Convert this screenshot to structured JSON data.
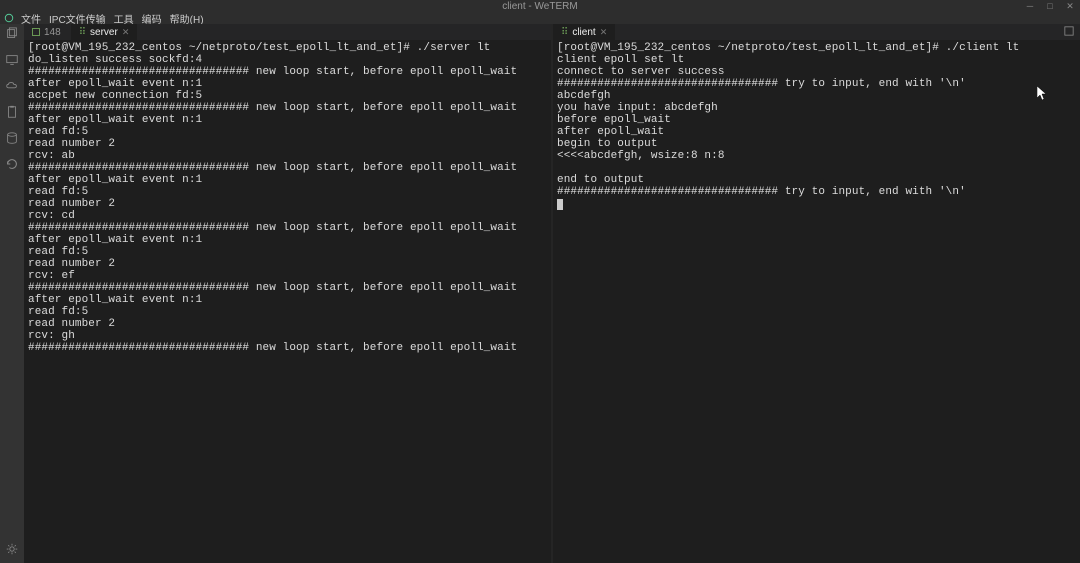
{
  "window": {
    "title": "client - WeTERM"
  },
  "menu": {
    "file": "文件",
    "ipc": "IPC文件传输",
    "tool": "工具",
    "encoding": "编码",
    "help": "帮助(H)"
  },
  "tabs": {
    "left_tab0": "148",
    "left_tab1": "server",
    "right_tab0": "client"
  },
  "server_output": "[root@VM_195_232_centos ~/netproto/test_epoll_lt_and_et]# ./server lt\ndo_listen success sockfd:4\n################################# new loop start, before epoll epoll_wait\nafter epoll_wait event n:1\naccpet new connection fd:5\n################################# new loop start, before epoll epoll_wait\nafter epoll_wait event n:1\nread fd:5\nread number 2\nrcv: ab\n################################# new loop start, before epoll epoll_wait\nafter epoll_wait event n:1\nread fd:5\nread number 2\nrcv: cd\n################################# new loop start, before epoll epoll_wait\nafter epoll_wait event n:1\nread fd:5\nread number 2\nrcv: ef\n################################# new loop start, before epoll epoll_wait\nafter epoll_wait event n:1\nread fd:5\nread number 2\nrcv: gh\n################################# new loop start, before epoll epoll_wait",
  "client_output": "[root@VM_195_232_centos ~/netproto/test_epoll_lt_and_et]# ./client lt\nclient epoll set lt\nconnect to server success\n################################# try to input, end with '\\n'\nabcdefgh\nyou have input: abcdefgh\nbefore epoll_wait\nafter epoll_wait\nbegin to output\n<<<<abcdefgh, wsize:8 n:8\n\nend to output\n################################# try to input, end with '\\n'"
}
